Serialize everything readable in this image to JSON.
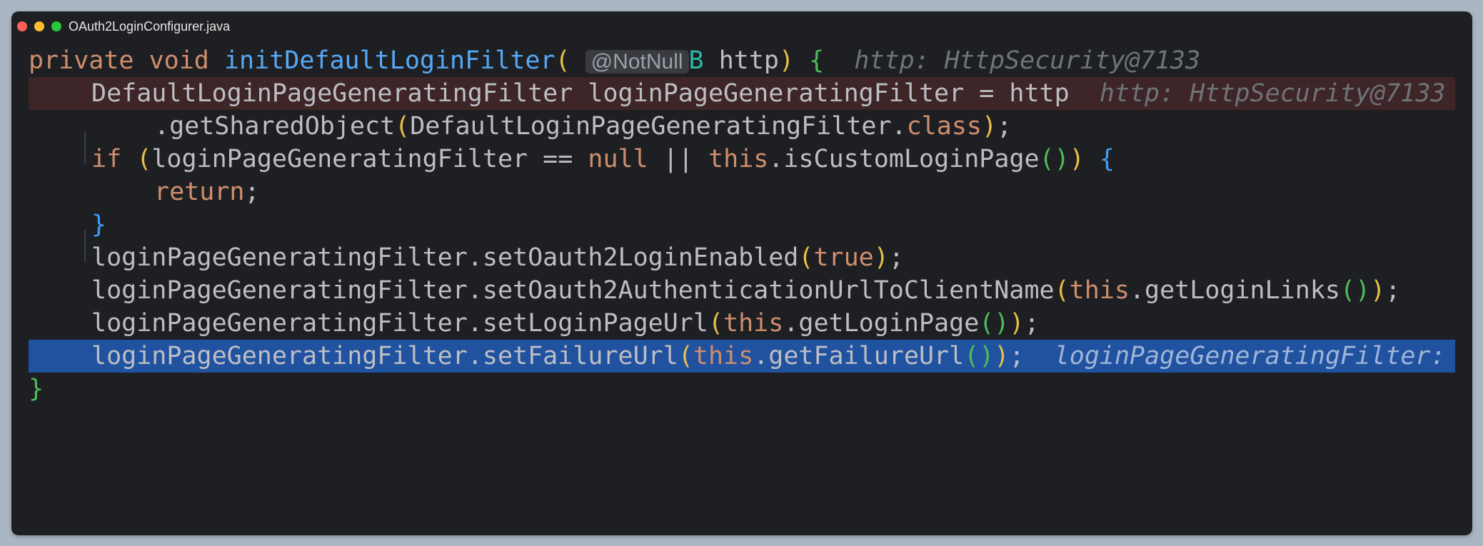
{
  "window": {
    "title": "OAuth2LoginConfigurer.java"
  },
  "colors": {
    "background": "#1e1f22",
    "keyword": "#cf8e6d",
    "method": "#56a8f5",
    "error_line": "#3e2527",
    "selected_line": "#2152a0"
  },
  "code": {
    "l1": {
      "kw1": "private",
      "kw2": "void",
      "method": "initDefaultLoginFilter",
      "paren_open": "(",
      "annotation": "@NotNull",
      "type": "B",
      "name": " http",
      "paren_close": ")",
      "brace": "{",
      "hint": "http: HttpSecurity@7133"
    },
    "l2": {
      "text": "DefaultLoginPageGeneratingFilter loginPageGeneratingFilter = http",
      "hint": "http: HttpSecurity@7133"
    },
    "l3": {
      "prefix": ".getSharedObject",
      "paren_open": "(",
      "arg": "DefaultLoginPageGeneratingFilter.",
      "kw": "class",
      "paren_close": ")",
      "semi": ";"
    },
    "l4": {
      "kw": "if",
      "paren_open": "(",
      "cond1": "loginPageGeneratingFilter == ",
      "null": "null",
      "or": " || ",
      "this": "this",
      "call": ".isCustomLoginPage",
      "inner": "()",
      "paren_close": ")",
      "brace": "{"
    },
    "l5": {
      "kw": "return",
      "semi": ";"
    },
    "l6": {
      "brace": "}"
    },
    "l7": {
      "text": "loginPageGeneratingFilter.setOauth2LoginEnabled",
      "paren_open": "(",
      "kw": "true",
      "paren_close": ")",
      "semi": ";"
    },
    "l8": {
      "text": "loginPageGeneratingFilter.setOauth2AuthenticationUrlToClientName",
      "paren_open": "(",
      "this": "this",
      "call": ".getLoginLinks",
      "inner": "()",
      "paren_close": ")",
      "semi": ";"
    },
    "l9": {
      "text": "loginPageGeneratingFilter.setLoginPageUrl",
      "paren_open": "(",
      "this": "this",
      "call": ".getLoginPage",
      "inner": "()",
      "paren_close": ")",
      "semi": ";"
    },
    "l10": {
      "text": "loginPageGeneratingFilter.setFailureUrl",
      "paren_open": "(",
      "this": "this",
      "call": ".getFailureUrl",
      "inner": "()",
      "paren_close": ")",
      "semi": ";",
      "hint": "loginPageGeneratingFilter: DefaultLoginPageGeneratingFilter"
    },
    "l11": {
      "brace": "}"
    }
  }
}
